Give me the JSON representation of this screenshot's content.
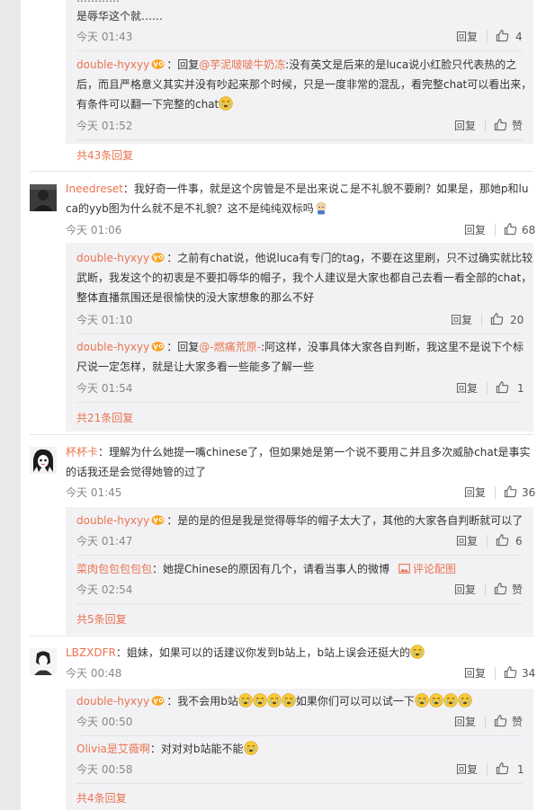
{
  "ui": {
    "reply": "回复",
    "like_placeholder": "赞"
  },
  "block1": {
    "top_text": "是辱华这个就……",
    "time1": "今天 01:43",
    "like1": "4",
    "sub2_user": "double-hyxyy",
    "sub2_prefix": "：回复",
    "sub2_mention": "@芋泥啵啵牛奶冻",
    "sub2_text": ":没有英文是后来的是luca说小红脸只代表热的之后，而且严格意义其实并没有吵起来那个时候，只是一度非常的混乱，看完整chat可以看出来，有条件可以翻一下完整的chat",
    "time2": "今天 01:52",
    "like2": "赞",
    "more": "共43条回复"
  },
  "c1": {
    "user": "Ineedreset",
    "text": "：我好奇一件事，就是这个房管是不是出来说こ是不礼貌不要刷？如果是，那她p和luca的yyb图为什么就不是不礼貌？这不是纯纯双标吗",
    "time": "今天 01:06",
    "like": "68",
    "r1_user": "double-hyxyy",
    "r1_text": "：之前有chat说，他说luca有专门的tag，不要在这里刷，只不过确实就比较武断，我发这个的初衷是不要扣辱华的帽子，我个人建议是大家也都自己去看一看全部的chat，整体直播氛围还是很愉快的没大家想象的那么不好",
    "r1_time": "今天 01:10",
    "r1_like": "20",
    "r2_user": "double-hyxyy",
    "r2_prefix": "：回复",
    "r2_mention": "@-燃痛荒原-",
    "r2_text": ":阿这样，没事具体大家各自判断，我这里不是说下个标尺说一定怎样，就是让大家多看一些能多了解一些",
    "r2_time": "今天 01:54",
    "r2_like": "1",
    "more": "共21条回复"
  },
  "c2": {
    "user": "杯杯卡",
    "text": "：理解为什么她提一嘴chinese了，但如果她是第一个说不要用こ并且多次威胁chat是事实的话我还是会觉得她管的过了",
    "time": "今天 01:45",
    "like": "36",
    "r1_user": "double-hyxyy",
    "r1_text": "：是的是的但是我是觉得辱华的帽子太大了，其他的大家各自判断就可以了",
    "r1_time": "今天 01:47",
    "r1_like": "6",
    "r2_user": "菜肉包包包包包",
    "r2_text": "：她提Chinese的原因有几个，请看当事人的微博",
    "r2_pic": "评论配图",
    "r2_time": "今天 02:54",
    "r2_like": "赞",
    "more": "共5条回复"
  },
  "c3": {
    "user": "LBZXDFR",
    "text": "：姐妹，如果可以的话建议你发到b站上，b站上误会还挺大的",
    "time": "今天 00:48",
    "like": "34",
    "r1_user": "double-hyxyy",
    "r1_text_a": "：我不会用b站",
    "r1_text_b": "如果你们可以可以试一下",
    "r1_time": "今天 00:50",
    "r1_like": "赞",
    "r2_user": "Olivia是艾薇啊",
    "r2_text": "：对对对b站能不能",
    "r2_time": "今天 00:58",
    "r2_like": "1",
    "more": "共4条回复"
  }
}
